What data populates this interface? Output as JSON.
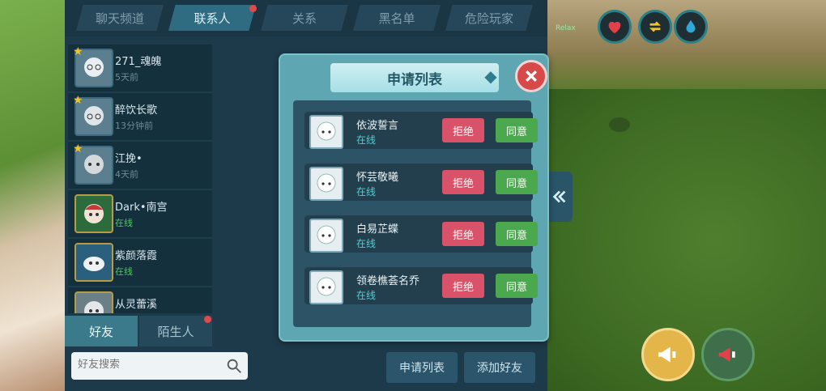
{
  "tabs": [
    {
      "label": "聊天频道"
    },
    {
      "label": "联系人"
    },
    {
      "label": "关系"
    },
    {
      "label": "黑名单"
    },
    {
      "label": "危险玩家"
    }
  ],
  "friends": [
    {
      "name": "271_魂魄",
      "status": "5天前",
      "online": false,
      "starred": true
    },
    {
      "name": "醉饮长歌",
      "status": "13分钟前",
      "online": false,
      "starred": true
    },
    {
      "name": "江挽•",
      "status": "4天前",
      "online": false,
      "starred": true
    },
    {
      "name": "Dark•南宫",
      "status": "在线",
      "online": true,
      "starred": false
    },
    {
      "name": "紫颜落霞",
      "status": "在线",
      "online": true,
      "starred": false
    },
    {
      "name": "从灵蕾溪",
      "status": "",
      "online": false,
      "starred": false
    }
  ],
  "bottom_tabs": {
    "friends": "好友",
    "strangers": "陌生人"
  },
  "search": {
    "placeholder": "好友搜索"
  },
  "buttons": {
    "request_list": "申请列表",
    "add_friend": "添加好友"
  },
  "hud": {
    "label": "Relax"
  },
  "dialog": {
    "title": "申请列表",
    "reject_label": "拒绝",
    "accept_label": "同意",
    "requests": [
      {
        "name": "依波誓言",
        "status": "在线"
      },
      {
        "name": "怀芸敬曦",
        "status": "在线"
      },
      {
        "name": "白易芷蝶",
        "status": "在线"
      },
      {
        "name": "领卷樵荟名乔",
        "status": "在线"
      }
    ]
  },
  "colors": {
    "reject": "#d8526a",
    "accept": "#4ba84e",
    "panel": "#1d3a4a",
    "dialog": "#5fa6b3"
  }
}
